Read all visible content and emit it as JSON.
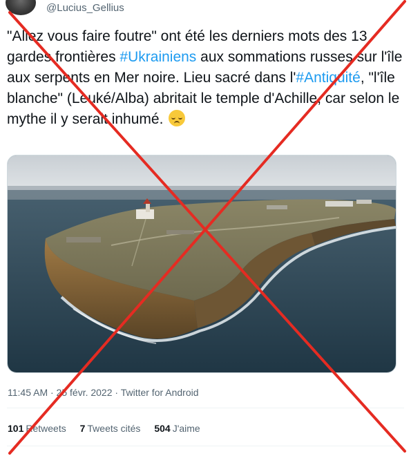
{
  "tweet": {
    "handle": "@Lucius_Gellius",
    "text_parts": {
      "p1": "\"Allez vous faire foutre\" ont été les derniers mots des 13 gardes frontières ",
      "tag1": "#Ukrainiens",
      "p2": " aux sommations russes sur l'île aux serpents en Mer noire. Lieu sacré dans l'",
      "tag2": "#Antiquité",
      "p3": ", \"l'île blanche\" (Leuké/Alba) abritait le temple d'Achille, car selon le mythe il y serait inhumé. "
    },
    "emoji": "pensive-face-icon",
    "photo": "aerial-island-photo",
    "meta": "11:45 AM · 25 févr. 2022 · Twitter for Android",
    "stats": {
      "retweets_num": "101",
      "retweets_label": "Retweets",
      "quotes_num": "7",
      "quotes_label": "Tweets cités",
      "likes_num": "504",
      "likes_label": "J'aime"
    }
  },
  "overlay": {
    "type": "red-cross",
    "color": "#e52b22"
  },
  "colors": {
    "text": "#0f1419",
    "secondary": "#536471",
    "link": "#1d9bf0"
  }
}
